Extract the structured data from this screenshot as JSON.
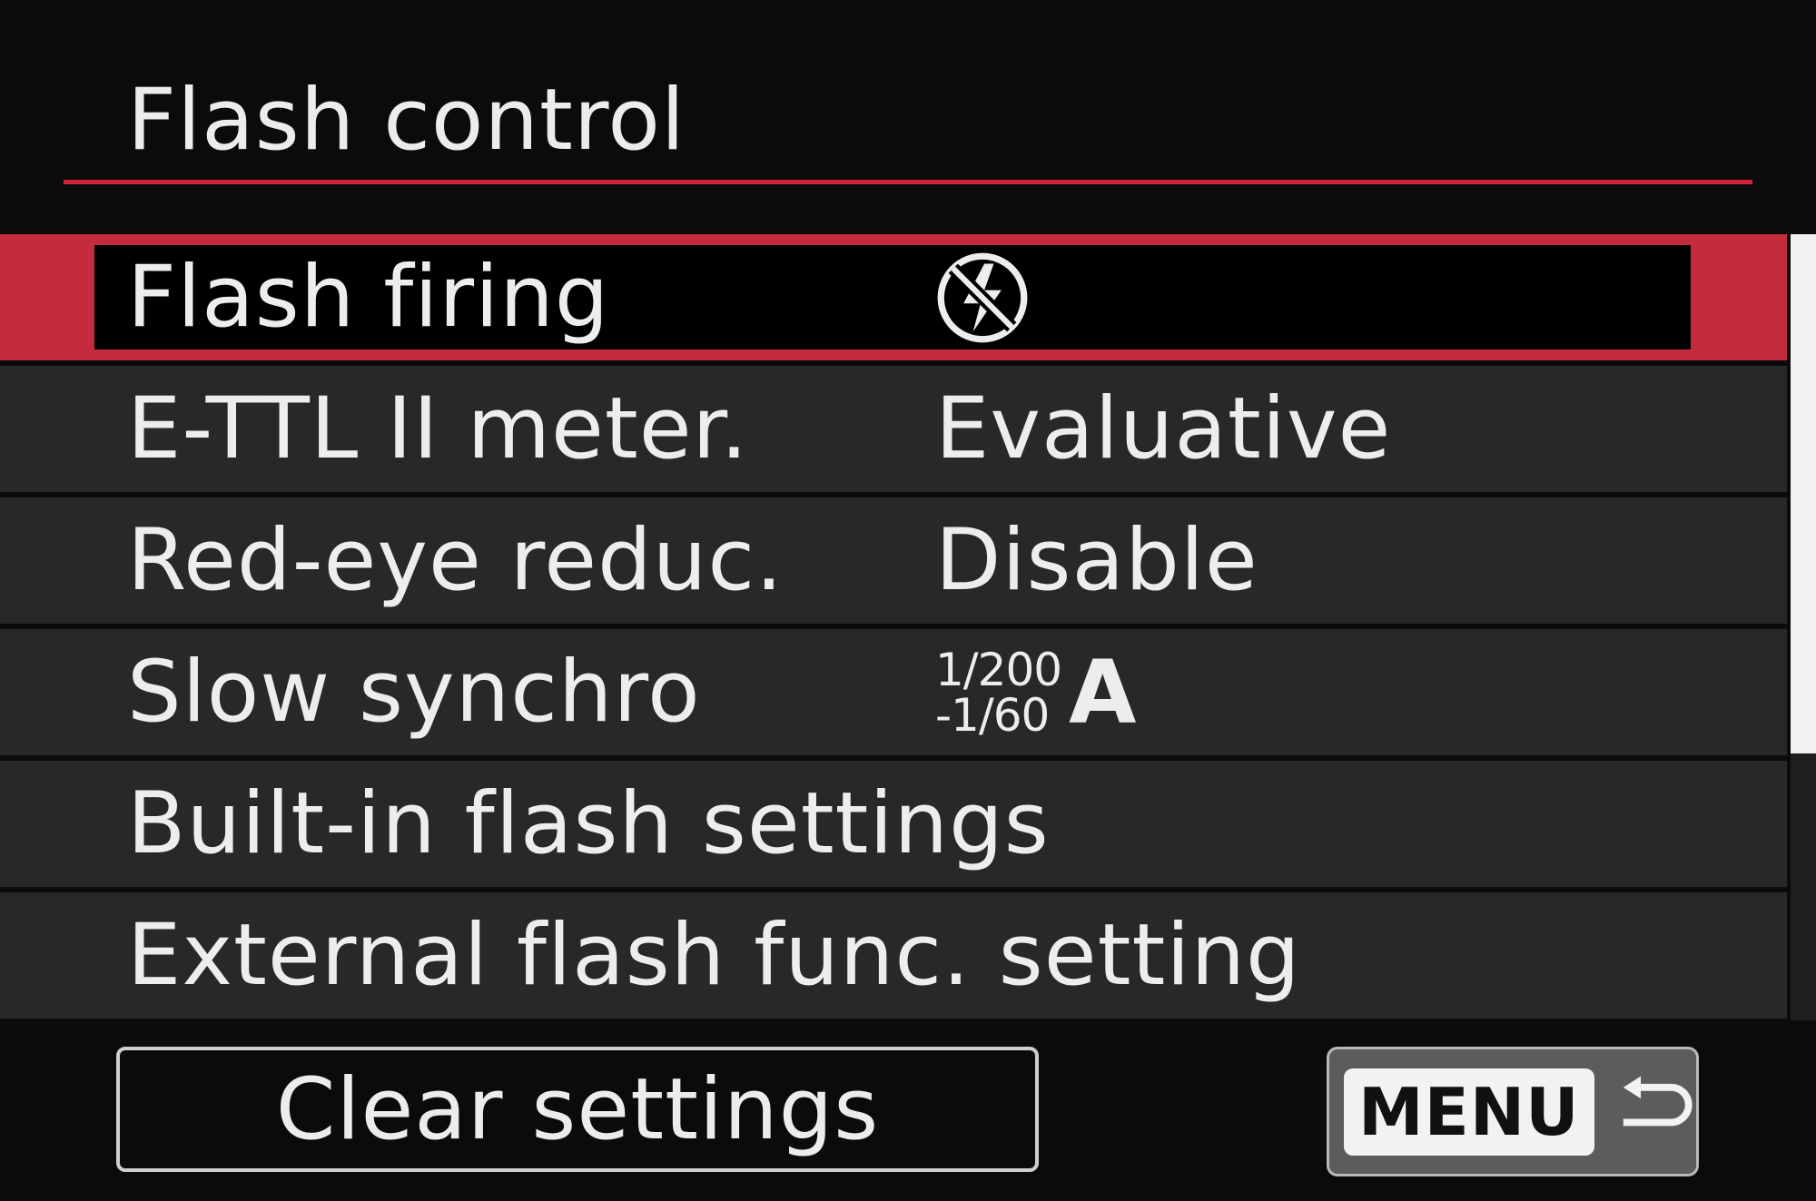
{
  "screen": {
    "title": "Flash control",
    "accent_color": "#d1223a",
    "selected_index": 0
  },
  "menu": {
    "items": [
      {
        "label": "Flash firing",
        "value_icon": "flash-off-icon"
      },
      {
        "label": "E-TTL II meter.",
        "value": "Evaluative"
      },
      {
        "label": "Red-eye reduc.",
        "value": "Disable"
      },
      {
        "label": "Slow synchro",
        "value_top": "1/200",
        "value_bottom": "-1/60",
        "value_mode": "A"
      },
      {
        "label": "Built-in flash settings"
      },
      {
        "label": "External flash func. setting"
      }
    ]
  },
  "scroll": {
    "visible_fraction": 0.66
  },
  "footer": {
    "clear_label": "Clear settings",
    "menu_label": "MENU",
    "back_icon": "return-arrow-icon"
  }
}
